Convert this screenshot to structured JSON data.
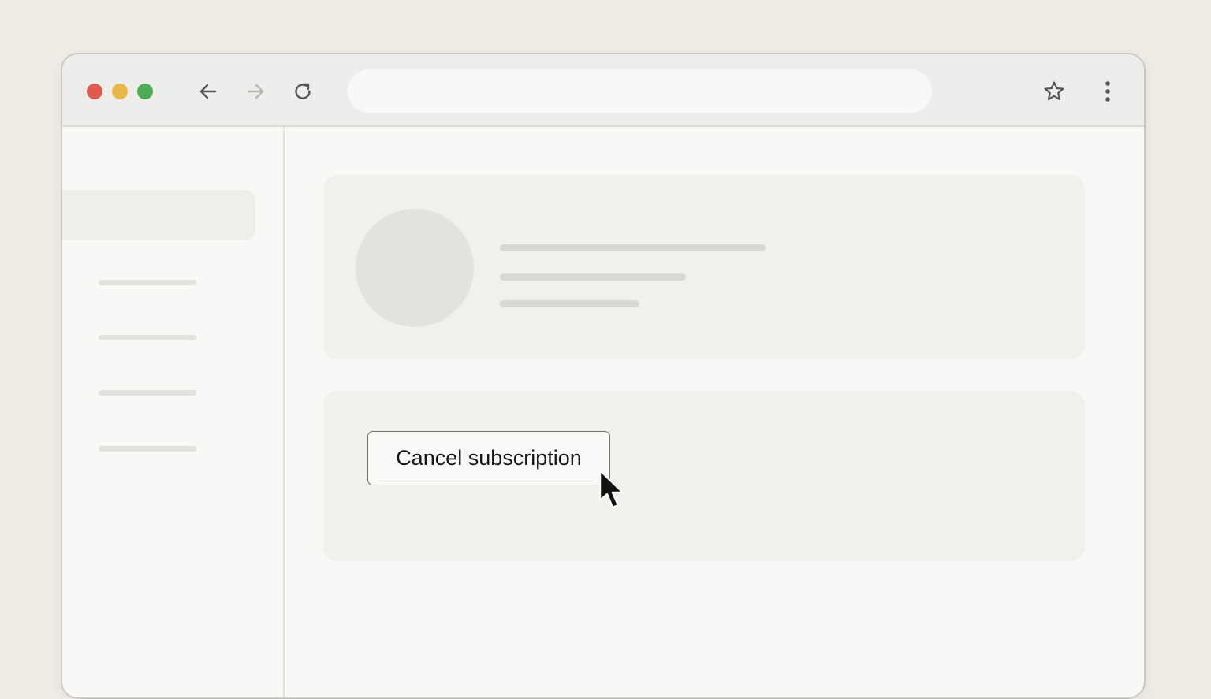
{
  "browser": {
    "window_controls": {
      "close_color": "#e25a4c",
      "minimize_color": "#e8b94a",
      "maximize_color": "#4fae55"
    },
    "nav": {
      "back_icon": "arrow-left-icon",
      "forward_icon": "arrow-right-icon",
      "reload_icon": "reload-icon"
    },
    "address_bar": {
      "value": "",
      "placeholder": ""
    },
    "actions": {
      "bookmark_icon": "star-icon",
      "menu_icon": "kebab-menu-icon"
    }
  },
  "sidebar": {
    "items": [
      "",
      "",
      "",
      ""
    ]
  },
  "main": {
    "subscription_card": {
      "cancel_button_label": "Cancel subscription"
    }
  },
  "cursor": {
    "icon": "mouse-pointer-icon"
  }
}
